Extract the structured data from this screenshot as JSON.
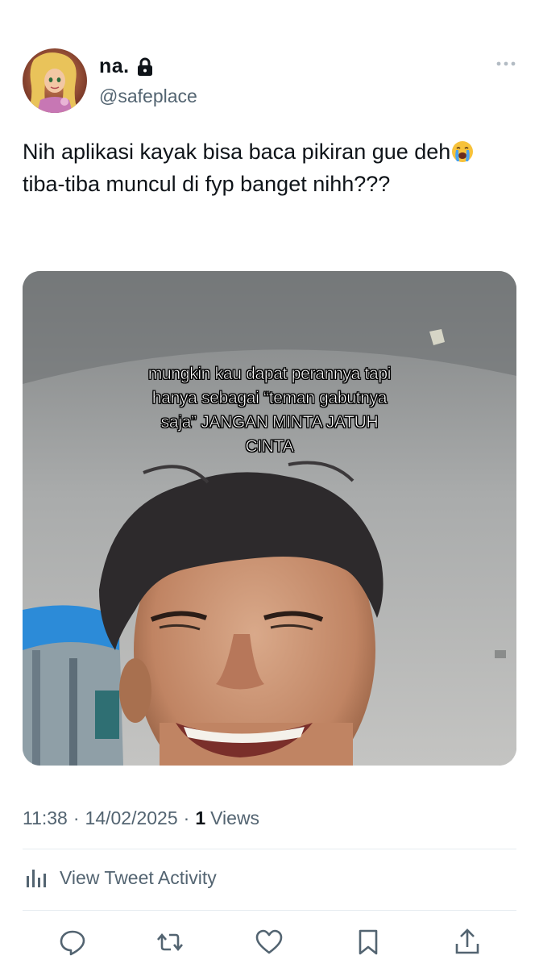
{
  "account": {
    "display_name": "na.",
    "handle": "@safeplace",
    "protected": true
  },
  "tweet": {
    "text_part1": "Nih aplikasi kayak bisa baca pikiran gue deh",
    "text_part2": " tiba-tiba muncul di fyp banget nihh???",
    "emoji": "loudly-crying-face",
    "media_caption": "mungkin kau dapat perannya tapi hanya sebagai “teman gabutnya saja” JANGAN MINTA JATUH CINTA"
  },
  "meta": {
    "time": "11:38",
    "date": "14/02/2025",
    "separator": "·",
    "views_count": "1",
    "views_label": "Views"
  },
  "activity": {
    "label": "View Tweet Activity"
  },
  "actions": [
    "reply-icon",
    "retweet-icon",
    "like-icon",
    "bookmark-icon",
    "share-icon"
  ],
  "colors": {
    "text": "#0f1419",
    "secondary": "#536471",
    "divider": "#e6ecf0"
  }
}
